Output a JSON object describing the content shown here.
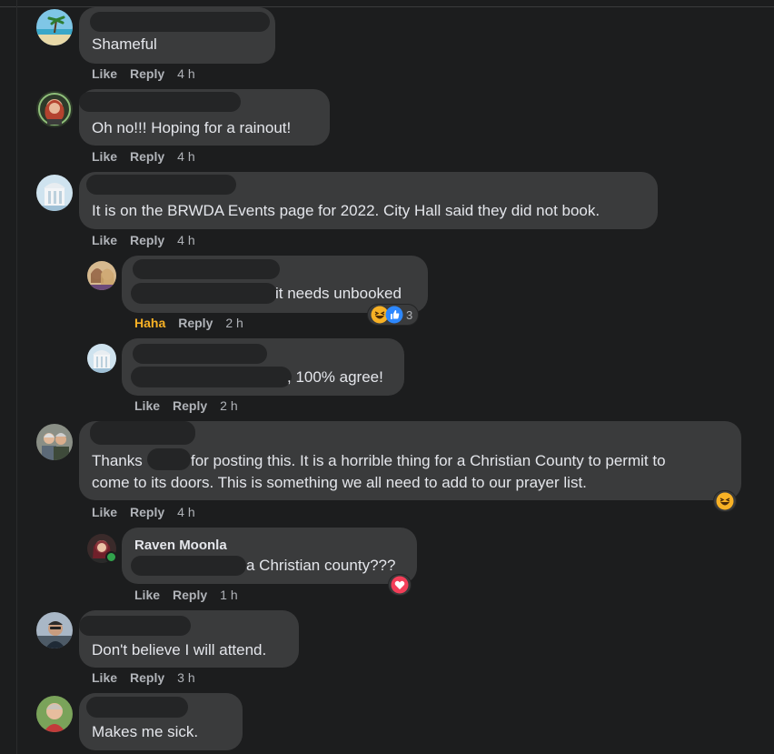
{
  "comments": [
    {
      "text": "Shameful",
      "like": "Like",
      "reply": "Reply",
      "time": "4 h"
    },
    {
      "text": "Oh no!!! Hoping for a rainout!",
      "like": "Like",
      "reply": "Reply",
      "time": "4 h"
    },
    {
      "text": "It is on the BRWDA Events page for 2022. City Hall said they did not book.",
      "like": "Like",
      "reply": "Reply",
      "time": "4 h"
    },
    {
      "text": "it needs unbooked",
      "reaction_count": "3",
      "like": "Haha",
      "reply": "Reply",
      "time": "2 h"
    },
    {
      "text": ", 100% agree!",
      "like": "Like",
      "reply": "Reply",
      "time": "2 h"
    },
    {
      "text_line1_a": "Thanks",
      "text_line1_b": "for posting this. It is a horrible thing for a Christian County to permit to",
      "text_line2": "come to its doors. This is something we all need to add to our prayer list.",
      "like": "Like",
      "reply": "Reply",
      "time": "4 h"
    },
    {
      "author": "Raven Moonla",
      "text": "a Christian county???",
      "like": "Like",
      "reply": "Reply",
      "time": "1 h"
    },
    {
      "text": "Don't believe I will attend.",
      "like": "Like",
      "reply": "Reply",
      "time": "3 h"
    },
    {
      "text": "Makes me sick."
    }
  ],
  "reaction_icons": [
    "haha-emoji-icon",
    "like-thumb-icon",
    "love-heart-icon"
  ],
  "colors": {
    "background": "#1c1d1e",
    "bubble": "#3a3b3c",
    "text": "#e4e6eb",
    "meta": "#b0b3b8",
    "haha": "#f7b125",
    "like_blue": "#2d88ff",
    "love_red": "#f33e58"
  }
}
